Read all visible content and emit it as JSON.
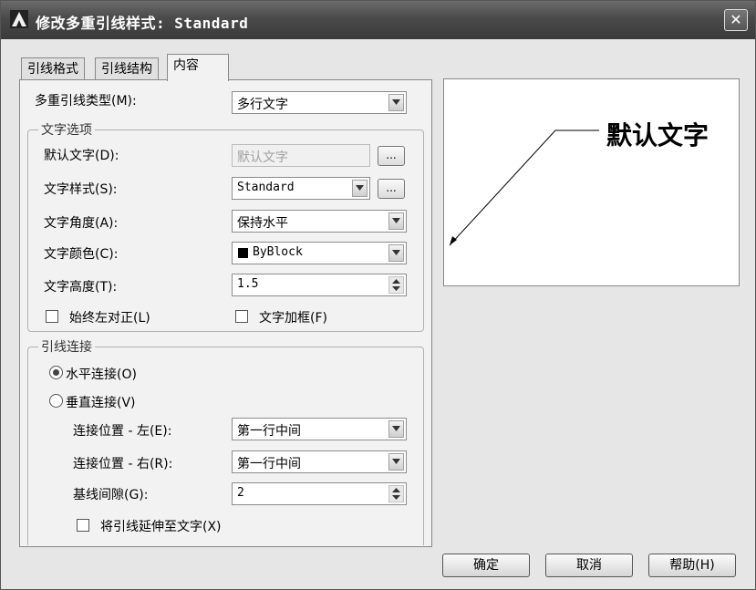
{
  "window": {
    "title": "修改多重引线样式: Standard",
    "close_glyph": "✕"
  },
  "tabs": [
    {
      "label": "引线格式",
      "active": false
    },
    {
      "label": "引线结构",
      "active": false
    },
    {
      "label": "内容",
      "active": true
    }
  ],
  "content": {
    "leader_type_label": "多重引线类型(M):",
    "leader_type_value": "多行文字",
    "text_options": {
      "title": "文字选项",
      "default_text_label": "默认文字(D):",
      "default_text_value": "默认文字",
      "text_style_label": "文字样式(S):",
      "text_style_value": "Standard",
      "text_angle_label": "文字角度(A):",
      "text_angle_value": "保持水平",
      "text_color_label": "文字颜色(C):",
      "text_color_value": "ByBlock",
      "text_color_swatch": "#000000",
      "text_height_label": "文字高度(T):",
      "text_height_value": "1.5",
      "always_left_label": "始终左对正(L)",
      "always_left_checked": false,
      "text_frame_label": "文字加框(F)",
      "text_frame_checked": false,
      "browse_label": "..."
    },
    "leader_connection": {
      "title": "引线连接",
      "horizontal_label": "水平连接(O)",
      "horizontal_checked": true,
      "vertical_label": "垂直连接(V)",
      "vertical_checked": false,
      "attach_left_label": "连接位置 - 左(E):",
      "attach_left_value": "第一行中间",
      "attach_right_label": "连接位置 - 右(R):",
      "attach_right_value": "第一行中间",
      "landing_gap_label": "基线间隙(G):",
      "landing_gap_value": "2",
      "extend_label": "将引线延伸至文字(X)",
      "extend_checked": false
    }
  },
  "preview": {
    "text": "默认文字"
  },
  "buttons": {
    "ok": "确定",
    "cancel": "取消",
    "help": "帮助(H)"
  }
}
